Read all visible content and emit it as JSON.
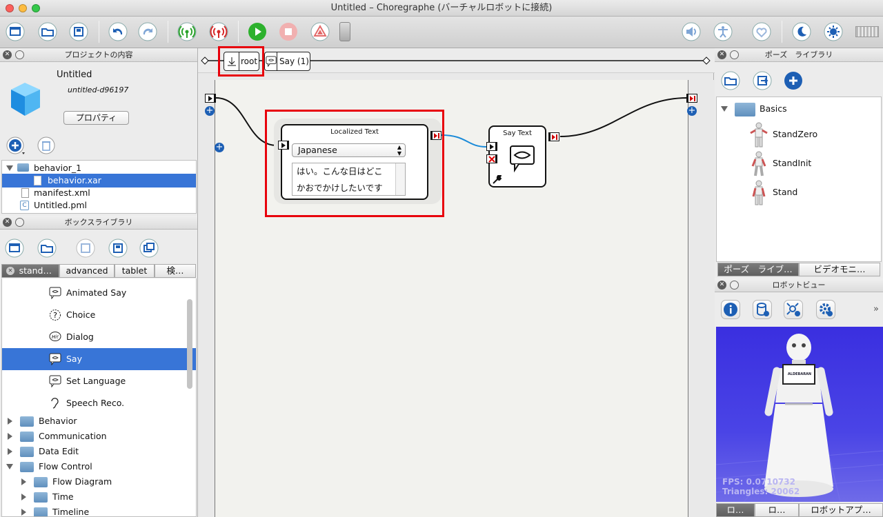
{
  "window": {
    "title": "Untitled – Choregraphe (バーチャルロボットに接続)"
  },
  "colors": {
    "accent": "#3875d7",
    "highlight": "#e8000b",
    "robot_bg": "#3c2fd8"
  },
  "project_panel": {
    "header": "プロジェクトの内容",
    "name": "Untitled",
    "id": "untitled-d96197",
    "properties_button": "プロパティ",
    "files": [
      "behavior_1",
      "behavior.xar",
      "manifest.xml",
      "Untitled.pml"
    ]
  },
  "box_library": {
    "header": "ボックスライブラリ",
    "tabs": [
      "stand…",
      "advanced",
      "tablet",
      "検…"
    ],
    "items": [
      "Animated Say",
      "Choice",
      "Dialog",
      "Say",
      "Set Language",
      "Speech Reco."
    ],
    "folders": [
      "Behavior",
      "Communication",
      "Data Edit",
      "Flow Control",
      "Flow Diagram",
      "Time",
      "Timeline"
    ]
  },
  "flow": {
    "breadcrumb_root": "root",
    "breadcrumb_say": "Say (1)",
    "localized_box": {
      "title": "Localized Text",
      "language": "Japanese",
      "text_line1": "はい。こんな日はどこ",
      "text_line2": "かおでかけしたいです"
    },
    "say_box": {
      "title": "Say Text"
    }
  },
  "pose_panel": {
    "header": "ポーズ　ライブラリ",
    "folder": "Basics",
    "poses": [
      "StandZero",
      "StandInit",
      "Stand"
    ],
    "tabs": [
      "ポーズ　ライブ…",
      "ビデオモニ…"
    ]
  },
  "robot_view": {
    "header": "ロボットビュー",
    "fps": "FPS: 0.0710732",
    "triangles": "Triangles: 20062",
    "badge": "ALDEBARAN",
    "tabs": [
      "ロ…",
      "ロ…",
      "ロボットアプ…"
    ]
  }
}
